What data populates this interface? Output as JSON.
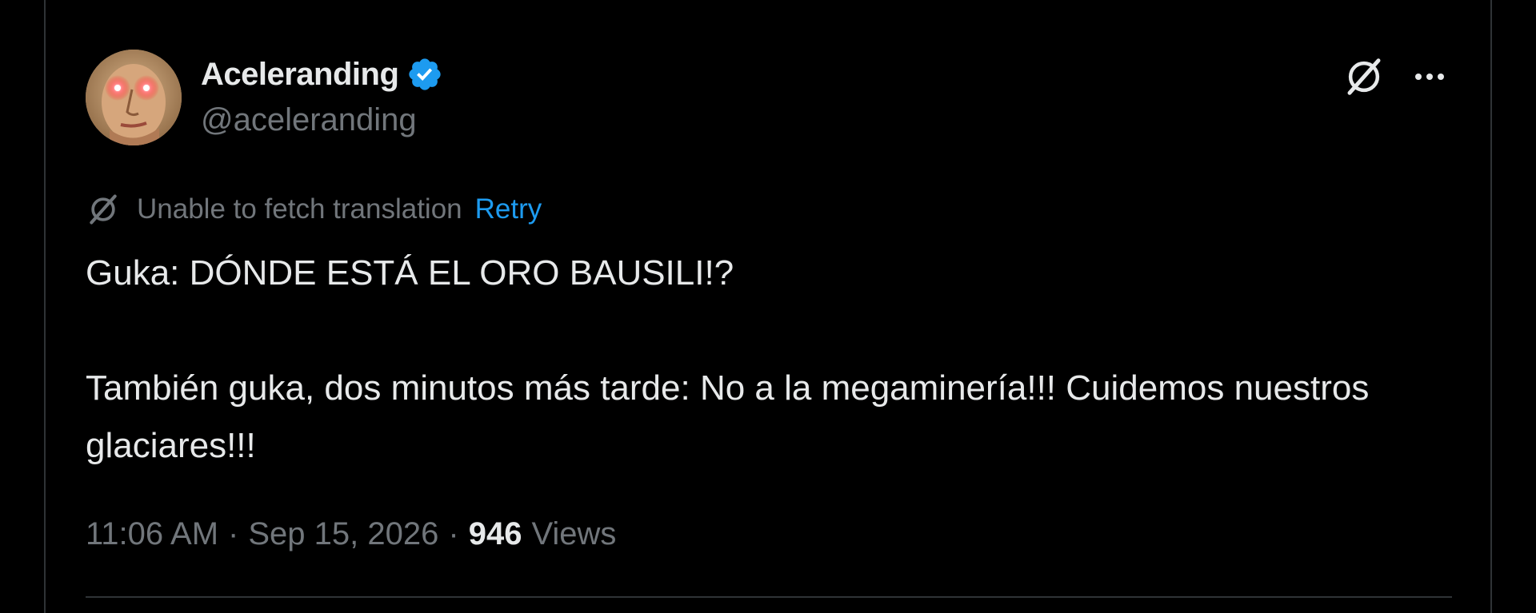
{
  "tweet": {
    "author": {
      "display_name": "Aceleranding",
      "handle": "@aceleranding",
      "verified": true
    },
    "translation": {
      "message": "Unable to fetch translation",
      "retry_label": "Retry"
    },
    "text": "Guka: DÓNDE ESTÁ EL ORO BAUSILI!?\n\nTambién guka, dos minutos más tarde: No a la megaminería!!! Cuidemos nuestros glaciares!!!",
    "time": "11:06 AM",
    "separator": "·",
    "date": "Sep 15, 2026",
    "views_count": "946",
    "views_label": "Views"
  },
  "icons": {
    "grok": "grok-icon",
    "more": "more-icon",
    "translate": "translate-icon",
    "verified": "verified-badge-icon"
  },
  "colors": {
    "background": "#000000",
    "text_primary": "#e7e9ea",
    "text_secondary": "#71767b",
    "accent": "#1d9bf0",
    "divider": "#2f3336"
  }
}
